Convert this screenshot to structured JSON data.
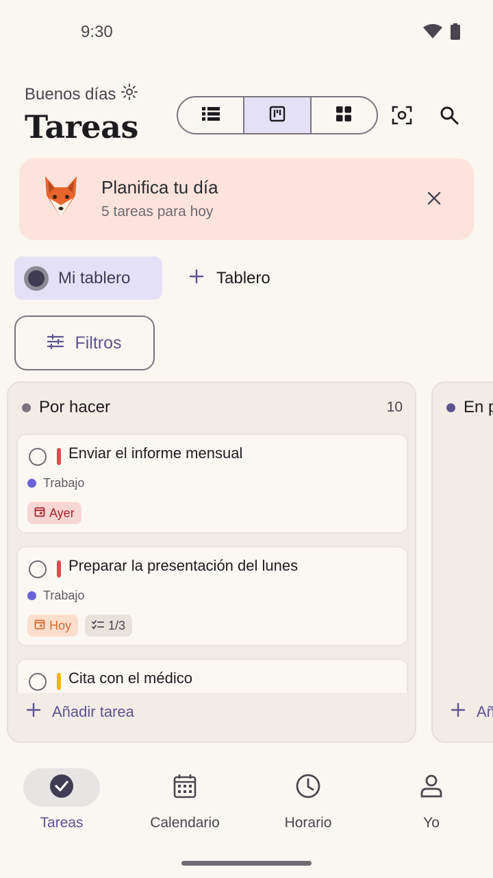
{
  "status": {
    "time": "9:30",
    "wifi_icon": "wifi-icon",
    "battery_icon": "battery-icon"
  },
  "header": {
    "greeting": "Buenos días",
    "greeting_icon": "sun-icon",
    "title": "Tareas",
    "view_modes": [
      {
        "icon": "list-view-icon",
        "selected": false
      },
      {
        "icon": "board-view-icon",
        "selected": true
      },
      {
        "icon": "grid-view-icon",
        "selected": false
      }
    ],
    "actions": [
      "scan-icon",
      "search-icon"
    ]
  },
  "banner": {
    "title": "Planifica tu día",
    "subtitle": "5 tareas para hoy",
    "mascot": "fox-mascot",
    "close_icon": "close-icon",
    "background": "#fce4dd"
  },
  "boards": {
    "active": "Mi tablero",
    "add_label": "Tablero"
  },
  "filters": {
    "label": "Filtros",
    "icon": "filter-icon"
  },
  "columns": [
    {
      "title": "Por hacer",
      "count": "10",
      "dot_color": "#79747e",
      "cards": [
        {
          "title": "Enviar el informe mensual",
          "priority_color": "#e5484d",
          "tag": "Trabajo",
          "chips": [
            {
              "type": "overdue",
              "label": "Ayer",
              "icon": "calendar-icon"
            }
          ]
        },
        {
          "title": "Preparar la presentación del lunes",
          "priority_color": "#e5484d",
          "tag": "Trabajo",
          "chips": [
            {
              "type": "today",
              "label": "Hoy",
              "icon": "calendar-icon"
            },
            {
              "type": "sub",
              "label": "1/3",
              "icon": "checklist-icon"
            }
          ]
        },
        {
          "title": "Cita con el médico",
          "priority_color": "#f5b400",
          "tag": "",
          "chips": []
        }
      ],
      "add_task_label": "Añadir tarea"
    },
    {
      "title": "En p",
      "count": "",
      "dot_color": "#5b5490",
      "add_task_label": "Añ"
    }
  ],
  "nav": {
    "items": [
      {
        "label": "Tareas",
        "icon": "check-circle-icon",
        "active": true
      },
      {
        "label": "Calendario",
        "icon": "calendar-icon",
        "active": false
      },
      {
        "label": "Horario",
        "icon": "clock-icon",
        "active": false
      },
      {
        "label": "Yo",
        "icon": "person-icon",
        "active": false
      }
    ]
  },
  "colors": {
    "accent": "#5b5490",
    "background": "#faf6f1",
    "selected_chip": "#e4e1f7"
  }
}
